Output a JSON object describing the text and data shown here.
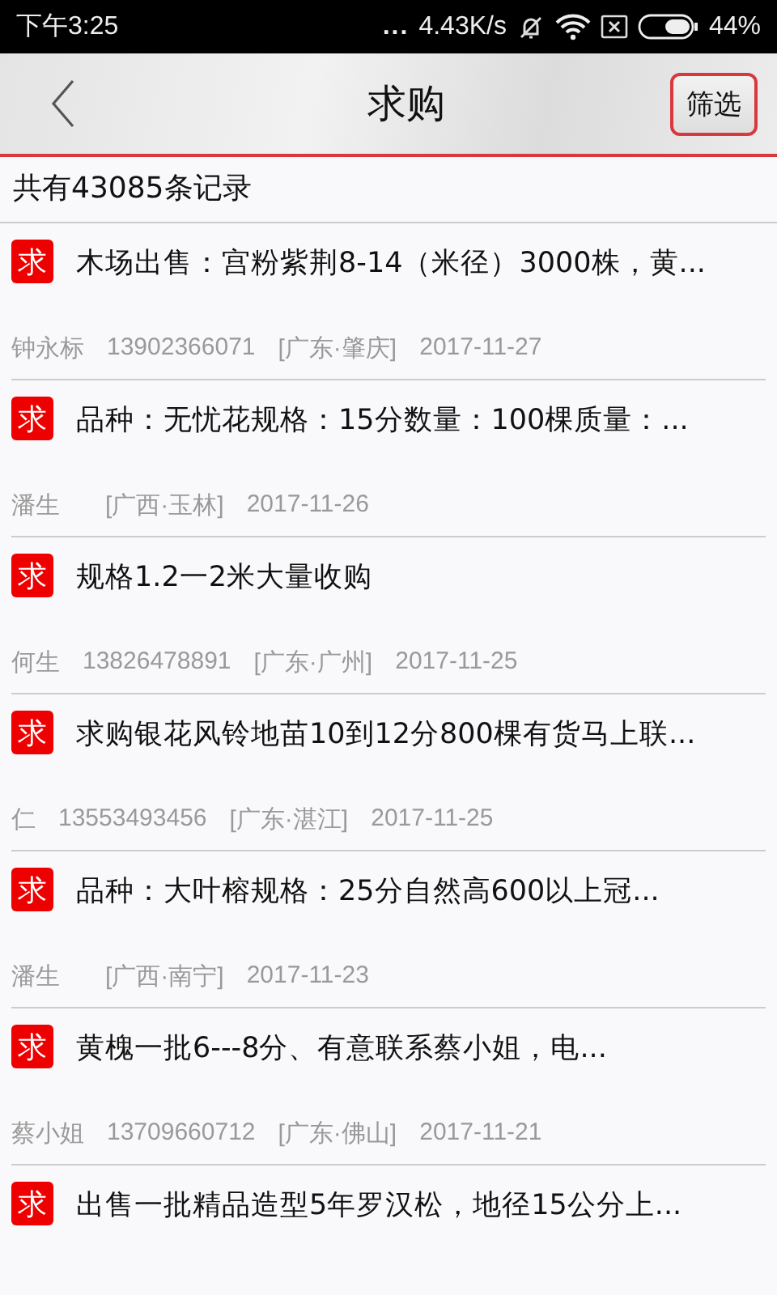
{
  "status_bar": {
    "time": "下午3:25",
    "dots": "...",
    "speed": "4.43K/s",
    "battery": "44%"
  },
  "header": {
    "title": "求购",
    "filter_button": "筛选"
  },
  "summary": "共有43085条记录",
  "listings": [
    {
      "badge": "求",
      "title": "木场出售：宫粉紫荆8-14（米径）3000株，黄...",
      "contact": "钟永标",
      "phone": "13902366071",
      "location": "[广东·肇庆]",
      "date": "2017-11-27"
    },
    {
      "badge": "求",
      "title": "品种：无忧花规格：15分数量：100棵质量：...",
      "contact": "潘生",
      "location": "[广西·玉林]",
      "date": "2017-11-26"
    },
    {
      "badge": "求",
      "title": "规格1.2一2米大量收购",
      "contact": "何生",
      "phone": "13826478891",
      "location": "[广东·广州]",
      "date": "2017-11-25"
    },
    {
      "badge": "求",
      "title": "求购银花风铃地苗10到12分800棵有货马上联...",
      "contact": "仁",
      "phone": "13553493456",
      "location": "[广东·湛江]",
      "date": "2017-11-25"
    },
    {
      "badge": "求",
      "title": "品种：大叶榕规格：25分自然高600以上冠...",
      "contact": "潘生",
      "location": "[广西·南宁]",
      "date": "2017-11-23"
    },
    {
      "badge": "求",
      "title": "黄槐一批6---8分、有意联系蔡小姐，电...",
      "contact": "蔡小姐",
      "phone": "13709660712",
      "location": "[广东·佛山]",
      "date": "2017-11-21"
    },
    {
      "badge": "求",
      "title": "出售一批精品造型5年罗汉松，地径15公分上..."
    }
  ]
}
